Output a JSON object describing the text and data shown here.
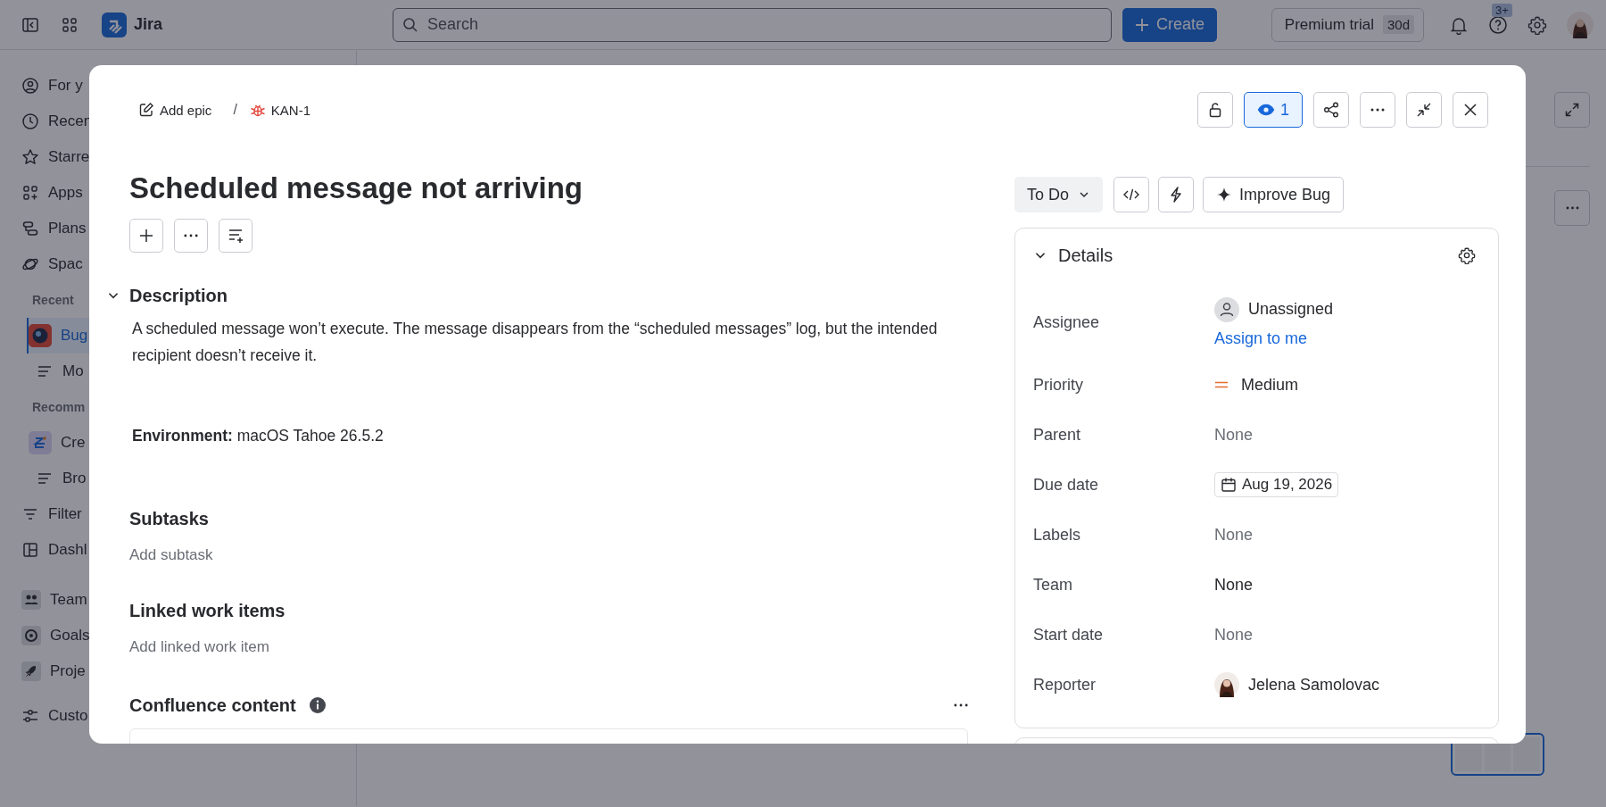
{
  "top_bar": {
    "product": "Jira",
    "search": {
      "placeholder": "Search"
    },
    "create_button": "Create",
    "trial": {
      "label": "Premium trial",
      "days": "30d"
    },
    "help_badge": "3+"
  },
  "sidebar": {
    "sections": [
      {
        "items": [
          {
            "kind": "link",
            "label": "For y",
            "selected": false
          },
          {
            "kind": "link",
            "label": "Recen",
            "selected": false
          },
          {
            "kind": "link",
            "label": "Starre",
            "selected": false
          },
          {
            "kind": "link",
            "label": "Apps",
            "selected": false
          },
          {
            "kind": "link",
            "label": "Plans",
            "selected": false
          },
          {
            "kind": "link",
            "label": "Spac",
            "selected": false
          },
          {
            "kind": "heading",
            "label": "Recent"
          },
          {
            "kind": "space",
            "label": "Bug",
            "selected": true
          },
          {
            "kind": "child",
            "label": "Mo",
            "selected": false
          },
          {
            "kind": "heading",
            "label": "Recomm"
          },
          {
            "kind": "space",
            "label": "Cre",
            "selected": false
          },
          {
            "kind": "child",
            "label": "Bro",
            "selected": false
          },
          {
            "kind": "link",
            "label": "Filter",
            "selected": false
          },
          {
            "kind": "link",
            "label": "Dashl",
            "selected": false
          }
        ]
      },
      {
        "items": [
          {
            "kind": "app",
            "label": "Team",
            "selected": false
          },
          {
            "kind": "app",
            "label": "Goals",
            "selected": false
          },
          {
            "kind": "app",
            "label": "Proje",
            "selected": false
          }
        ]
      },
      {
        "items": [
          {
            "kind": "link",
            "label": "Custo",
            "selected": false
          }
        ]
      }
    ]
  },
  "modal": {
    "breadcrumb": {
      "epic": "Add epic",
      "separator": "/",
      "key": "KAN-1"
    },
    "watch": {
      "count": "1",
      "on": true
    },
    "title": "Scheduled message not arriving",
    "description": {
      "heading": "Description",
      "expanded": true,
      "paragraphs": [
        "A scheduled message won’t execute. The message disappears from the “scheduled messages” log, but the intended recipient doesn’t receive it.",
        "**Environment:** macOS Tahoe 26.5.2"
      ]
    },
    "sections": [
      {
        "heading": "Subtasks",
        "action": "Add subtask"
      },
      {
        "heading": "Linked work items",
        "action": "Add linked work item"
      }
    ],
    "confluence": {
      "heading": "Confluence content"
    },
    "status": "To Do",
    "improve_button": "Improve Bug",
    "details": {
      "heading": "Details",
      "expanded": true,
      "fields": [
        {
          "label": "Assignee",
          "kind": "assignee",
          "value": "Unassigned",
          "action": "Assign to me"
        },
        {
          "label": "Priority",
          "kind": "priority",
          "value": "Medium"
        },
        {
          "label": "Parent",
          "kind": "empty",
          "value": "None"
        },
        {
          "label": "Due date",
          "kind": "date",
          "value": "Aug 19, 2026"
        },
        {
          "label": "Labels",
          "kind": "empty",
          "value": "None"
        },
        {
          "label": "Team",
          "kind": "text",
          "value": "None"
        },
        {
          "label": "Start date",
          "kind": "empty",
          "value": "None"
        },
        {
          "label": "Reporter",
          "kind": "person",
          "value": "Jelena Samolovac"
        }
      ]
    }
  }
}
